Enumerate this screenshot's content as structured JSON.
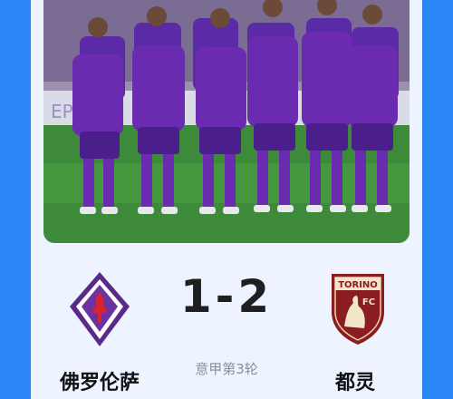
{
  "match": {
    "home_team": "佛罗伦萨",
    "away_team": "都灵",
    "score": "1-2",
    "round": "意甲第3轮"
  },
  "photo": {
    "banner_text": "EPI",
    "kit_color": "#6a2bb0"
  },
  "away_crest": {
    "text_top": "TORINO",
    "text_fc": "FC"
  },
  "colors": {
    "background": "#2a86f5",
    "card": "#eef4ff",
    "fiorentina_purple": "#5b2a86",
    "torino_maroon": "#8b1c22"
  }
}
